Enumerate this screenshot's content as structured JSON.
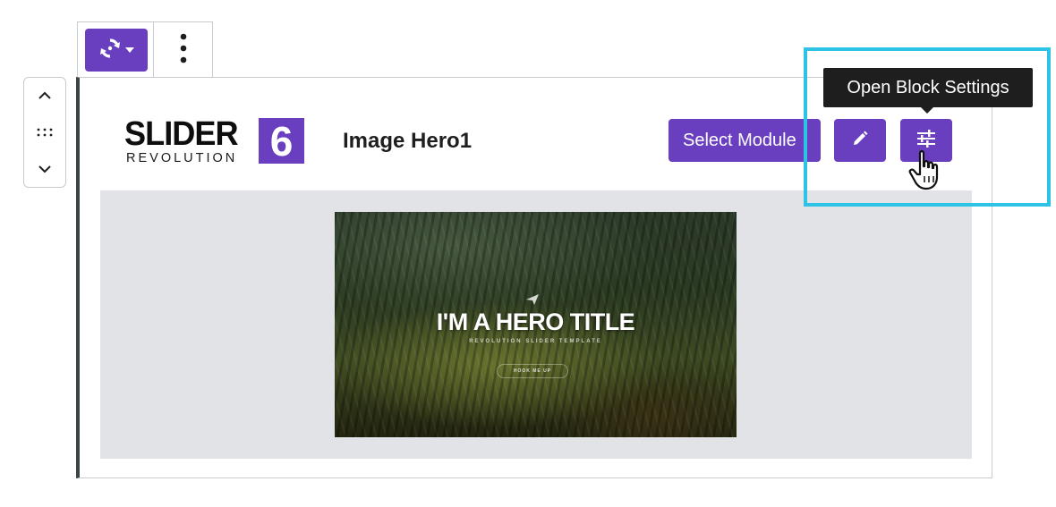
{
  "toolbar": {
    "transform_icon": "transform-loop-icon",
    "dropdown_icon": "caret-down-icon",
    "more_icon": "vertical-ellipsis-icon"
  },
  "mover": {
    "up_icon": "chevron-up-icon",
    "drag_icon": "drag-handle-icon",
    "down_icon": "chevron-down-icon"
  },
  "block": {
    "logo": {
      "word": "SLIDER",
      "sub": "REVOLUTION",
      "number": "6"
    },
    "module_title": "Image Hero1",
    "select_module_label": "Select Module",
    "edit_icon": "pencil-icon",
    "settings_icon": "sliders-icon",
    "preview": {
      "title": "I'M A HERO TITLE",
      "subtitle": "REVOLUTION SLIDER TEMPLATE",
      "button": "HOOK ME UP"
    }
  },
  "tooltip": {
    "text": "Open Block Settings"
  },
  "colors": {
    "accent": "#6a3fbf",
    "highlight": "#2ec3e5",
    "tooltip_bg": "#1e1e1e",
    "preview_bg": "#e1e3e7"
  }
}
